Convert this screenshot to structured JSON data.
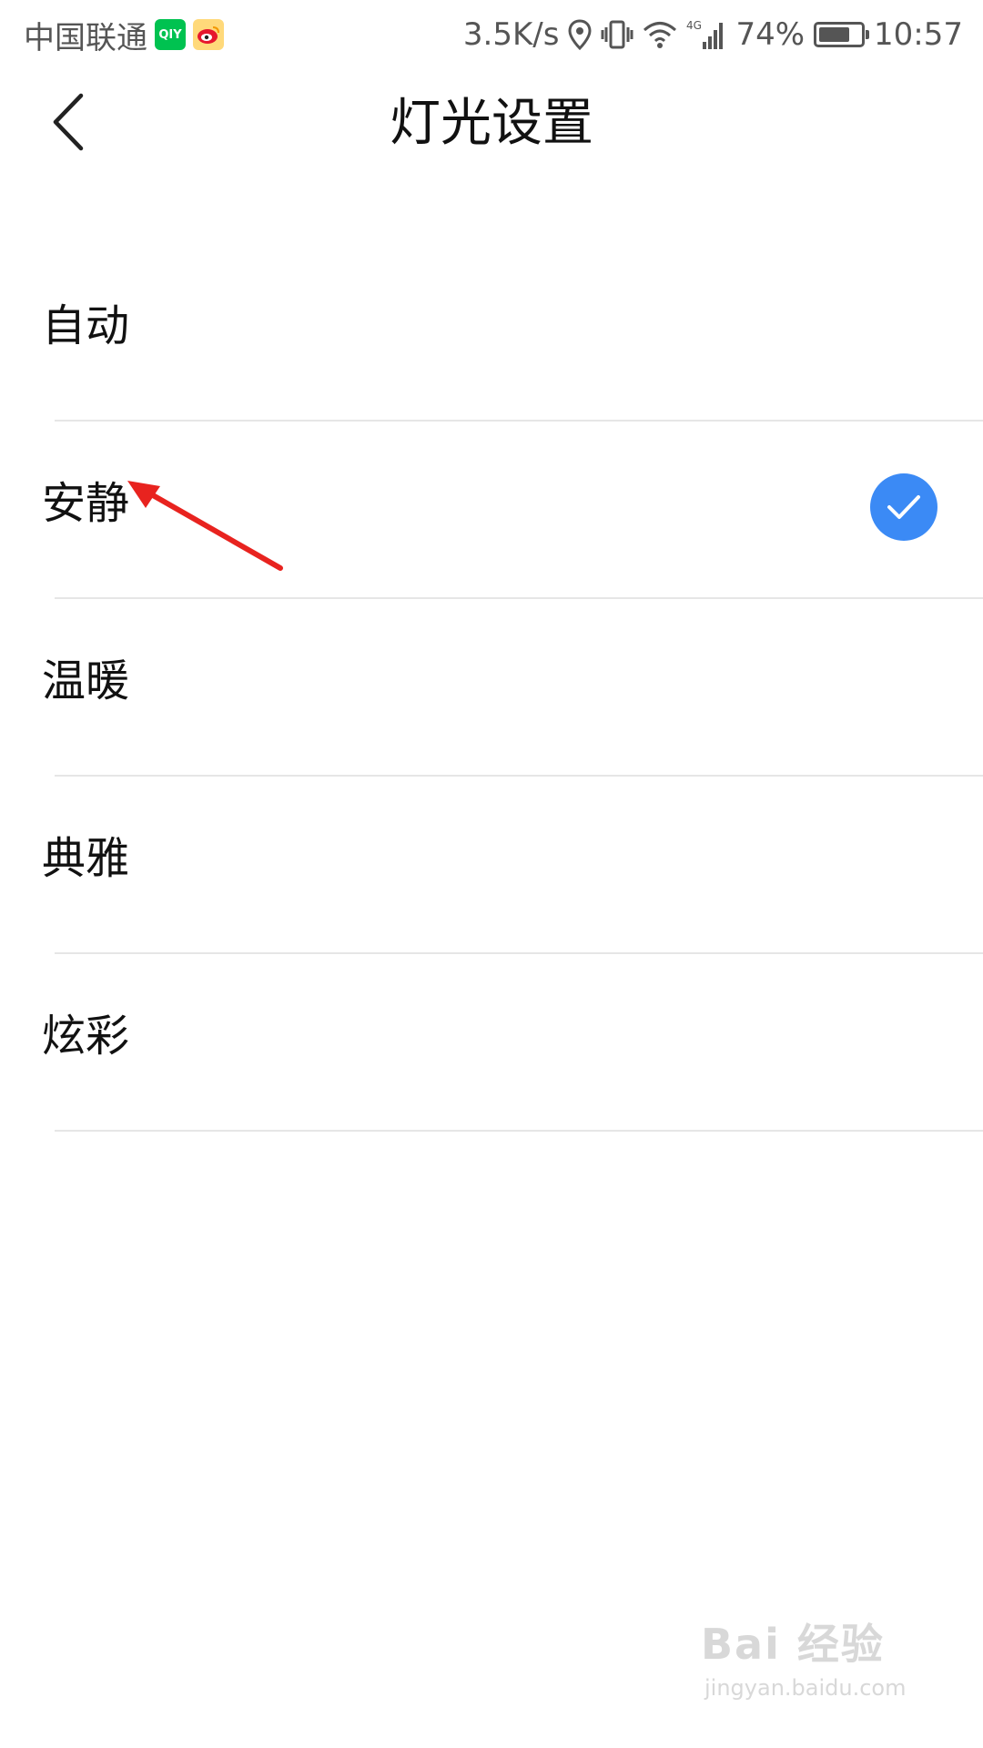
{
  "status_bar": {
    "carrier": "中国联通",
    "app_icons": [
      "iqiyi-icon",
      "weibo-icon"
    ],
    "iqiyi_badge": "QIY",
    "network_speed": "3.5K/s",
    "network_type": "4G",
    "battery_percent": "74%",
    "battery_level": 0.74,
    "time": "10:57"
  },
  "header": {
    "back_icon": "chevron-left-icon",
    "title": "灯光设置"
  },
  "options": [
    {
      "label": "自动",
      "selected": false
    },
    {
      "label": "安静",
      "selected": true
    },
    {
      "label": "温暖",
      "selected": false
    },
    {
      "label": "典雅",
      "selected": false
    },
    {
      "label": "炫彩",
      "selected": false
    }
  ],
  "colors": {
    "accent": "#3b8af5",
    "annotation": "#e8231f",
    "divider": "#e6e6e6"
  },
  "watermark": {
    "brand": "Bai 经验",
    "url": "jingyan.baidu.com"
  }
}
